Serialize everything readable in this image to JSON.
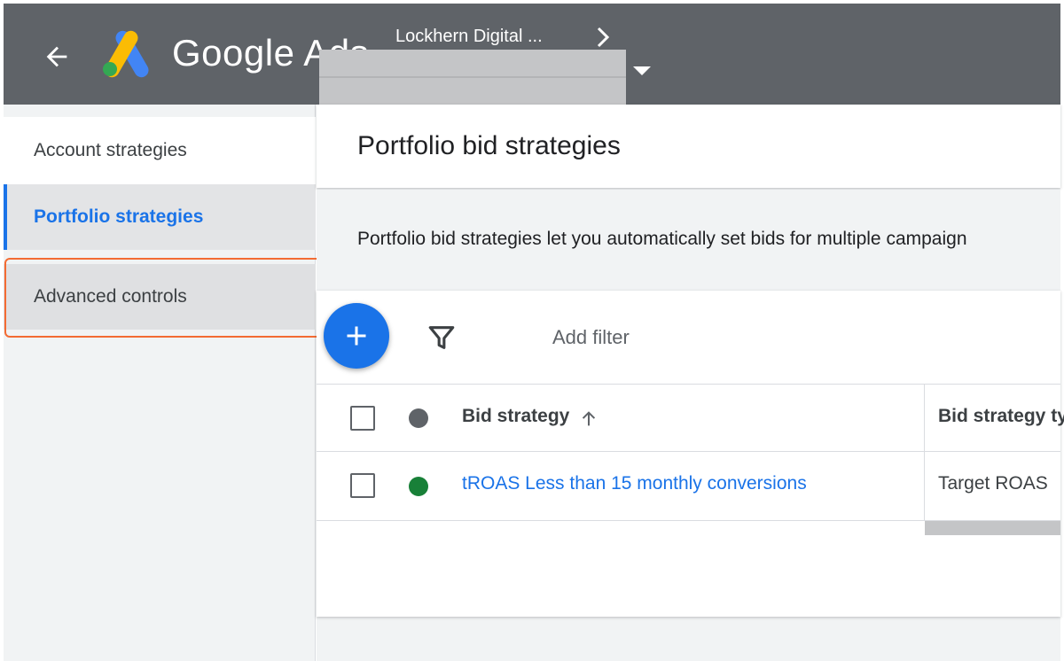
{
  "header": {
    "brand": "Google Ads",
    "account_name": "Lockhern Digital ..."
  },
  "sidebar": {
    "items": [
      {
        "label": "Account strategies"
      },
      {
        "label": "Portfolio strategies"
      },
      {
        "label": "Advanced controls"
      }
    ]
  },
  "main": {
    "title": "Portfolio bid strategies",
    "description": "Portfolio bid strategies let you automatically set bids for multiple campaign"
  },
  "toolbar": {
    "add_filter_label": "Add filter"
  },
  "table": {
    "columns": [
      "Bid strategy",
      "Bid strategy ty"
    ],
    "rows": [
      {
        "bid_strategy": "tROAS Less than 15 monthly conversions",
        "bid_strategy_type": "Target ROAS",
        "status": "enabled"
      }
    ]
  },
  "colors": {
    "header_bg": "#5f6368",
    "accent": "#1a73e8",
    "status_enabled": "#188038",
    "highlight": "#f36b33"
  },
  "icons": [
    "back-arrow-icon",
    "google-ads-logo",
    "chevron-right-icon",
    "dropdown-caret-icon",
    "plus-icon",
    "filter-icon",
    "arrow-up-icon"
  ]
}
